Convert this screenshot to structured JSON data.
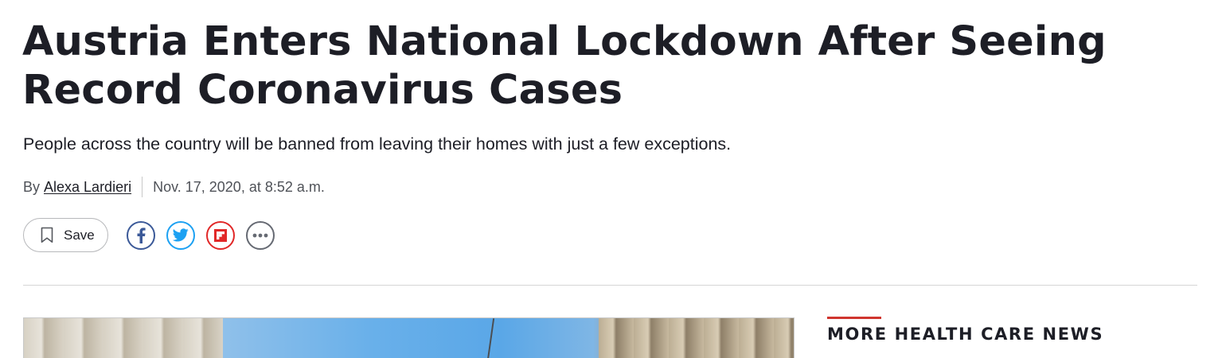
{
  "article": {
    "headline": "Austria Enters National Lockdown After Seeing Record Coronavirus Cases",
    "dek": "People across the country will be banned from leaving their homes with just a few exceptions.",
    "byline_prefix": "By",
    "author": "Alexa Lardieri",
    "date": "Nov. 17, 2020, at 8:52 a.m."
  },
  "actions": {
    "save_label": "Save",
    "save_icon": "bookmark-icon",
    "share": [
      {
        "network": "facebook",
        "icon": "facebook-icon",
        "color": "#3b5998"
      },
      {
        "network": "twitter",
        "icon": "twitter-icon",
        "color": "#1da1f2"
      },
      {
        "network": "flipboard",
        "icon": "flipboard-icon",
        "color": "#e12828"
      },
      {
        "network": "more",
        "icon": "more-icon",
        "color": "#666a73"
      }
    ]
  },
  "sidebar": {
    "heading": "MORE HEALTH CARE NEWS",
    "accent_color": "#d0352e"
  },
  "colors": {
    "text": "#1d1e26",
    "meta_text": "#4f5258",
    "divider": "#d6d6d6"
  }
}
